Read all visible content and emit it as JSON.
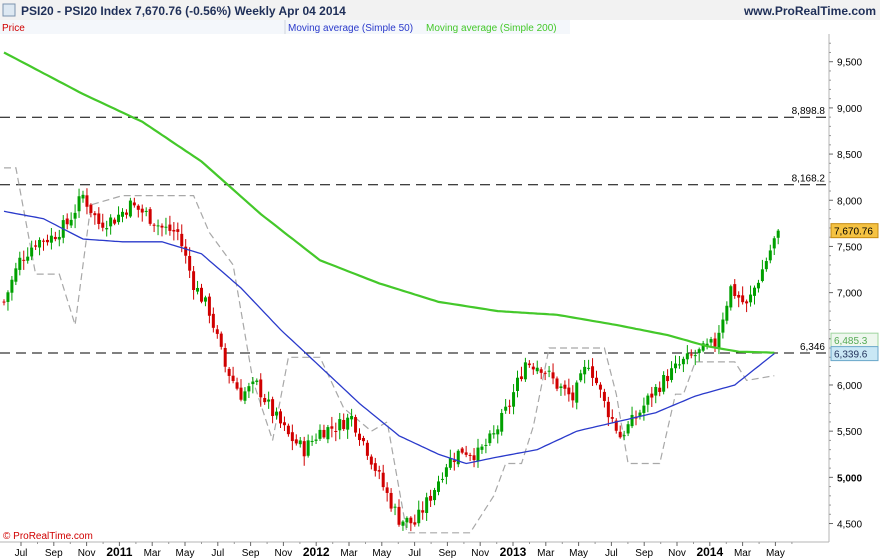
{
  "header": {
    "title": "PSI20 - PSI20 Index    7,670.76 (-0.56%)    Weekly  Apr 04 2014",
    "site": "www.ProRealTime.com",
    "legend_price": "Price",
    "legend_ma50": "Moving average (Simple 50)",
    "legend_ma200": "Moving average (Simple 200)",
    "watermark": "© ProRealTime.com"
  },
  "colors": {
    "up": "#00a000",
    "down": "#d00000",
    "ma50": "#2a3acb",
    "ma200": "#44c82a",
    "envelope": "#a8a8a8",
    "current_badge": "#f5c242",
    "ma50_badge": "#c9e7f5"
  },
  "chart_data": {
    "type": "candlestick",
    "ylim": [
      4300,
      9800
    ],
    "y_ticks": [
      4500,
      5000,
      5500,
      6000,
      6500,
      7000,
      7500,
      8000,
      8500,
      9000,
      9500
    ],
    "y_tick_labels": [
      "4,500",
      "5,000",
      "5,500",
      "6,000",
      "6,500",
      "7,000",
      "7,500",
      "8,000",
      "8,500",
      "9,000",
      "9,500"
    ],
    "x_tick_labels": [
      "Jul",
      "Sep",
      "Nov",
      "2011",
      "Mar",
      "May",
      "Jul",
      "Sep",
      "Nov",
      "2012",
      "Mar",
      "May",
      "Jul",
      "Sep",
      "Nov",
      "2013",
      "Mar",
      "May",
      "Jul",
      "Sep",
      "Nov",
      "2014",
      "Mar",
      "May"
    ],
    "x_tick_bold": [
      false,
      false,
      false,
      true,
      false,
      false,
      false,
      false,
      false,
      true,
      false,
      false,
      false,
      false,
      false,
      true,
      false,
      false,
      false,
      false,
      false,
      true,
      false,
      false
    ],
    "horizontal_levels": [
      {
        "value": 8898.8,
        "label": "8,898.8"
      },
      {
        "value": 8168.2,
        "label": "8,168.2"
      },
      {
        "value": 6346,
        "label": "6,346"
      }
    ],
    "current_price": {
      "value": 7670.76,
      "label": "7,670.76"
    },
    "ma50_last": {
      "value": 6339.6,
      "label": "6,339.6"
    },
    "ma200_last": {
      "value": 6485.3,
      "label": "6,485.3"
    },
    "price_keypoints": [
      [
        0,
        6900
      ],
      [
        4,
        7350
      ],
      [
        8,
        7550
      ],
      [
        12,
        7600
      ],
      [
        16,
        7750
      ],
      [
        20,
        8050
      ],
      [
        24,
        7750
      ],
      [
        28,
        7800
      ],
      [
        32,
        7950
      ],
      [
        36,
        7850
      ],
      [
        40,
        7700
      ],
      [
        44,
        7650
      ],
      [
        48,
        7100
      ],
      [
        52,
        6800
      ],
      [
        56,
        6200
      ],
      [
        60,
        5900
      ],
      [
        64,
        6000
      ],
      [
        68,
        5700
      ],
      [
        72,
        5450
      ],
      [
        76,
        5300
      ],
      [
        80,
        5500
      ],
      [
        84,
        5550
      ],
      [
        88,
        5650
      ],
      [
        92,
        5300
      ],
      [
        96,
        4900
      ],
      [
        100,
        4550
      ],
      [
        104,
        4500
      ],
      [
        108,
        4800
      ],
      [
        112,
        5150
      ],
      [
        116,
        5300
      ],
      [
        120,
        5250
      ],
      [
        124,
        5450
      ],
      [
        128,
        5800
      ],
      [
        132,
        6250
      ],
      [
        136,
        6200
      ],
      [
        140,
        6000
      ],
      [
        144,
        5850
      ],
      [
        148,
        6250
      ],
      [
        152,
        5800
      ],
      [
        156,
        5450
      ],
      [
        160,
        5650
      ],
      [
        164,
        5900
      ],
      [
        168,
        6100
      ],
      [
        172,
        6250
      ],
      [
        176,
        6350
      ],
      [
        180,
        6450
      ],
      [
        184,
        7050
      ],
      [
        188,
        6850
      ],
      [
        192,
        7250
      ],
      [
        196,
        7670.76
      ]
    ],
    "ma50_keypoints": [
      [
        0,
        7880
      ],
      [
        10,
        7800
      ],
      [
        20,
        7580
      ],
      [
        30,
        7550
      ],
      [
        40,
        7550
      ],
      [
        50,
        7420
      ],
      [
        60,
        7050
      ],
      [
        70,
        6600
      ],
      [
        80,
        6200
      ],
      [
        90,
        5800
      ],
      [
        100,
        5450
      ],
      [
        110,
        5250
      ],
      [
        117,
        5150
      ],
      [
        125,
        5220
      ],
      [
        135,
        5300
      ],
      [
        145,
        5500
      ],
      [
        155,
        5600
      ],
      [
        165,
        5700
      ],
      [
        175,
        5880
      ],
      [
        185,
        6000
      ],
      [
        195,
        6339.6
      ]
    ],
    "ma200_keypoints": [
      [
        0,
        9600
      ],
      [
        20,
        9150
      ],
      [
        35,
        8850
      ],
      [
        50,
        8420
      ],
      [
        65,
        7850
      ],
      [
        80,
        7350
      ],
      [
        95,
        7100
      ],
      [
        110,
        6900
      ],
      [
        125,
        6800
      ],
      [
        140,
        6760
      ],
      [
        155,
        6650
      ],
      [
        168,
        6540
      ],
      [
        178,
        6420
      ],
      [
        186,
        6360
      ],
      [
        195,
        6350
      ]
    ],
    "envelope_keypoints": [
      [
        0,
        8350
      ],
      [
        3,
        8350
      ],
      [
        8,
        7200
      ],
      [
        14,
        7200
      ],
      [
        18,
        6650
      ],
      [
        22,
        7950
      ],
      [
        30,
        8050
      ],
      [
        48,
        8050
      ],
      [
        52,
        7650
      ],
      [
        58,
        7300
      ],
      [
        63,
        6050
      ],
      [
        68,
        5400
      ],
      [
        72,
        6300
      ],
      [
        80,
        6300
      ],
      [
        86,
        5750
      ],
      [
        93,
        5500
      ],
      [
        97,
        5600
      ],
      [
        102,
        4400
      ],
      [
        118,
        4400
      ],
      [
        124,
        4800
      ],
      [
        127,
        5150
      ],
      [
        131,
        5150
      ],
      [
        134,
        5550
      ],
      [
        138,
        6400
      ],
      [
        152,
        6400
      ],
      [
        155,
        5900
      ],
      [
        158,
        5150
      ],
      [
        166,
        5150
      ],
      [
        170,
        5900
      ],
      [
        172,
        5900
      ],
      [
        175,
        6250
      ],
      [
        185,
        6250
      ],
      [
        188,
        6050
      ],
      [
        195,
        6100
      ]
    ]
  }
}
